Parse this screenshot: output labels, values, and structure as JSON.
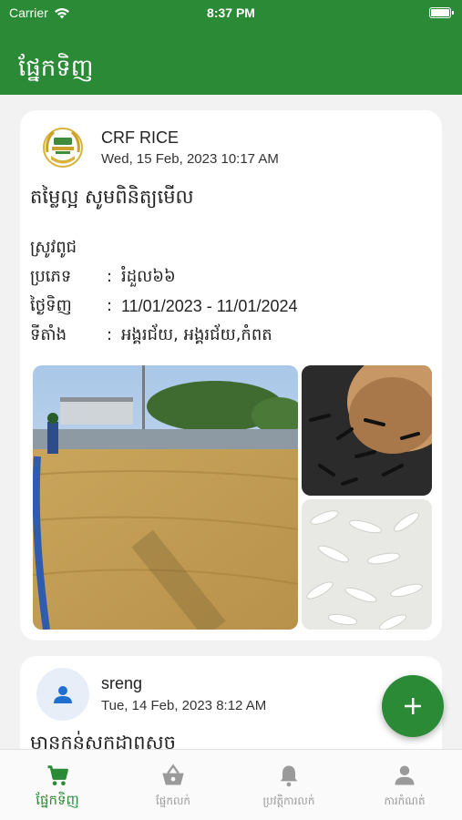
{
  "status_bar": {
    "carrier": "Carrier",
    "time": "8:37 PM",
    "icons": [
      "wifi-icon",
      "battery-icon"
    ]
  },
  "header": {
    "title": "ផ្នែកទិញ"
  },
  "posts": [
    {
      "author": "CRF RICE",
      "date": "Wed, 15 Feb, 2023 10:17 AM",
      "title": "តម្លៃល្អ សូមពិនិត្យមើល",
      "category": "ស្រូវពូជ",
      "details": [
        {
          "label": "ប្រភេទ",
          "value": "រំដួល៦៦"
        },
        {
          "label": "ថ្ងៃទិញ",
          "value": "11/01/2023 - 11/01/2024"
        },
        {
          "label": "ទីតាំង",
          "value": "អង្គរជ័យ, អង្គរជ័យ,កំពត"
        }
      ],
      "separator": ":",
      "images": [
        "rice-drying-field-photo",
        "black-rice-bowl-photo",
        "white-rice-grains-photo"
      ]
    },
    {
      "author": "sreng",
      "date": "Tue, 14 Feb, 2023 8:12 AM",
      "title": "មានកន់សកដាពសច"
    }
  ],
  "tabs": [
    {
      "label": "ផ្នែកទិញ",
      "icon": "cart-icon",
      "active": true
    },
    {
      "label": "ផ្នែកលក់",
      "icon": "basket-icon",
      "active": false
    },
    {
      "label": "ប្រវត្តិការលក់",
      "icon": "bell-icon",
      "active": false
    },
    {
      "label": "ការកំណត់",
      "icon": "person-icon",
      "active": false
    }
  ],
  "colors": {
    "primary_green": "#2a8a35",
    "background": "#f2f2f2",
    "card": "#ffffff",
    "inactive_tab": "#9a9a9a"
  }
}
